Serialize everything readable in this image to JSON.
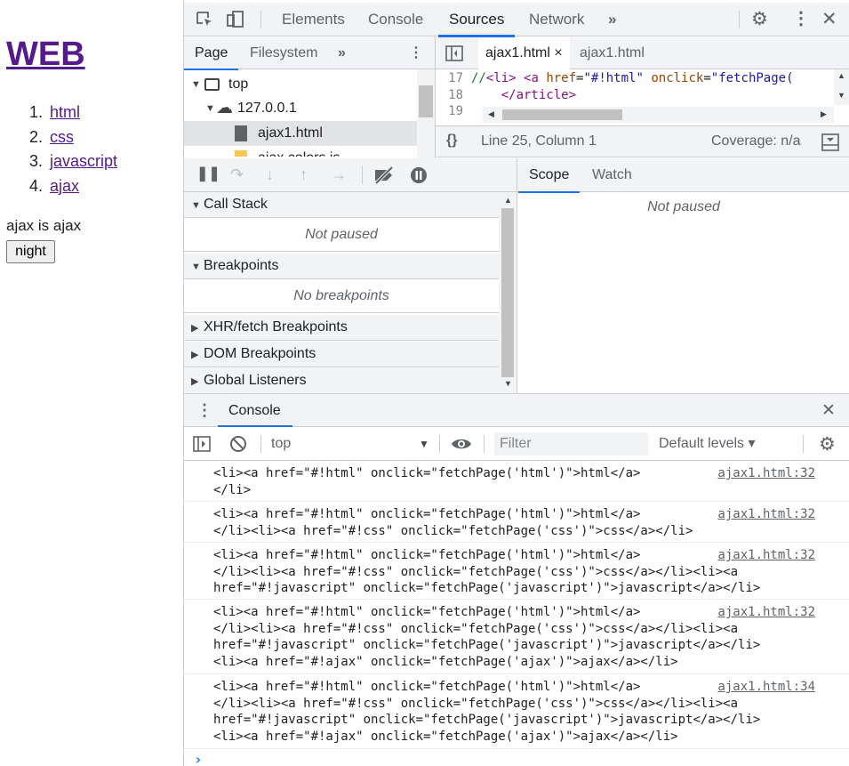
{
  "page": {
    "heading": "WEB",
    "nav": [
      {
        "num": "1.",
        "label": "html"
      },
      {
        "num": "2.",
        "label": "css"
      },
      {
        "num": "3.",
        "label": "javascript"
      },
      {
        "num": "4.",
        "label": "ajax"
      }
    ],
    "article_text": "ajax is ajax",
    "night_button": "night"
  },
  "devtools": {
    "main_tabs": [
      "Elements",
      "Console",
      "Sources",
      "Network"
    ],
    "active_main_tab": "Sources",
    "more_tabs_glyph": "»",
    "navigator": {
      "tabs": [
        "Page",
        "Filesystem"
      ],
      "active": "Page",
      "tree": {
        "top": "top",
        "host": "127.0.0.1",
        "selected_file": "ajax1.html",
        "partial_file": "ajax.colors.js"
      }
    },
    "editor": {
      "tabs": [
        "ajax1.html",
        "ajax1.html"
      ],
      "close_glyph": "×",
      "lines": [
        {
          "num": "17",
          "parts": [
            [
              "c-com",
              "//"
            ],
            [
              "c-tag",
              "<li>"
            ],
            [
              "",
              " "
            ],
            [
              "c-tag",
              "<a "
            ],
            [
              "c-at",
              "href"
            ],
            [
              "",
              "="
            ],
            [
              "c-val",
              "\"#!html\""
            ],
            [
              "",
              " "
            ],
            [
              "c-at",
              "onclick"
            ],
            [
              "",
              "="
            ],
            [
              "c-val",
              "\"fetchPage("
            ]
          ]
        },
        {
          "num": "18",
          "parts": [
            [
              "",
              "    "
            ],
            [
              "c-tag",
              "</article>"
            ]
          ]
        },
        {
          "num": "19",
          "parts": []
        }
      ],
      "status_position": "Line 25, Column 1",
      "coverage": "Coverage: n/a",
      "format_glyph": "{}"
    },
    "debugger": {
      "sections": {
        "call_stack": "Call Stack",
        "call_stack_msg": "Not paused",
        "breakpoints": "Breakpoints",
        "breakpoints_msg": "No breakpoints",
        "xhr": "XHR/fetch Breakpoints",
        "dom": "DOM Breakpoints",
        "global": "Global Listeners"
      },
      "scope_tabs": [
        "Scope",
        "Watch"
      ],
      "active_scope_tab": "Scope",
      "scope_msg": "Not paused"
    },
    "drawer": {
      "tab": "Console",
      "context": "top",
      "filter_placeholder": "Filter",
      "levels": "Default levels ▾",
      "prompt": "›",
      "logs": [
        {
          "text": "<li><a href=\"#!html\" onclick=\"fetchPage('html')\">html</a>\n</li>",
          "source": "ajax1.html:32"
        },
        {
          "text": "<li><a href=\"#!html\" onclick=\"fetchPage('html')\">html</a>\n</li><li><a href=\"#!css\" onclick=\"fetchPage('css')\">css</a></li>",
          "source": "ajax1.html:32"
        },
        {
          "text": "<li><a href=\"#!html\" onclick=\"fetchPage('html')\">html</a>\n</li><li><a href=\"#!css\" onclick=\"fetchPage('css')\">css</a></li><li><a\nhref=\"#!javascript\" onclick=\"fetchPage('javascript')\">javascript</a></li>",
          "source": "ajax1.html:32"
        },
        {
          "text": "<li><a href=\"#!html\" onclick=\"fetchPage('html')\">html</a>\n</li><li><a href=\"#!css\" onclick=\"fetchPage('css')\">css</a></li><li><a\nhref=\"#!javascript\" onclick=\"fetchPage('javascript')\">javascript</a></li>\n<li><a href=\"#!ajax\" onclick=\"fetchPage('ajax')\">ajax</a></li>",
          "source": "ajax1.html:32"
        },
        {
          "text": "<li><a href=\"#!html\" onclick=\"fetchPage('html')\">html</a>\n</li><li><a href=\"#!css\" onclick=\"fetchPage('css')\">css</a></li><li><a\nhref=\"#!javascript\" onclick=\"fetchPage('javascript')\">javascript</a></li>\n<li><a href=\"#!ajax\" onclick=\"fetchPage('ajax')\">ajax</a></li>",
          "source": "ajax1.html:34"
        }
      ]
    }
  }
}
